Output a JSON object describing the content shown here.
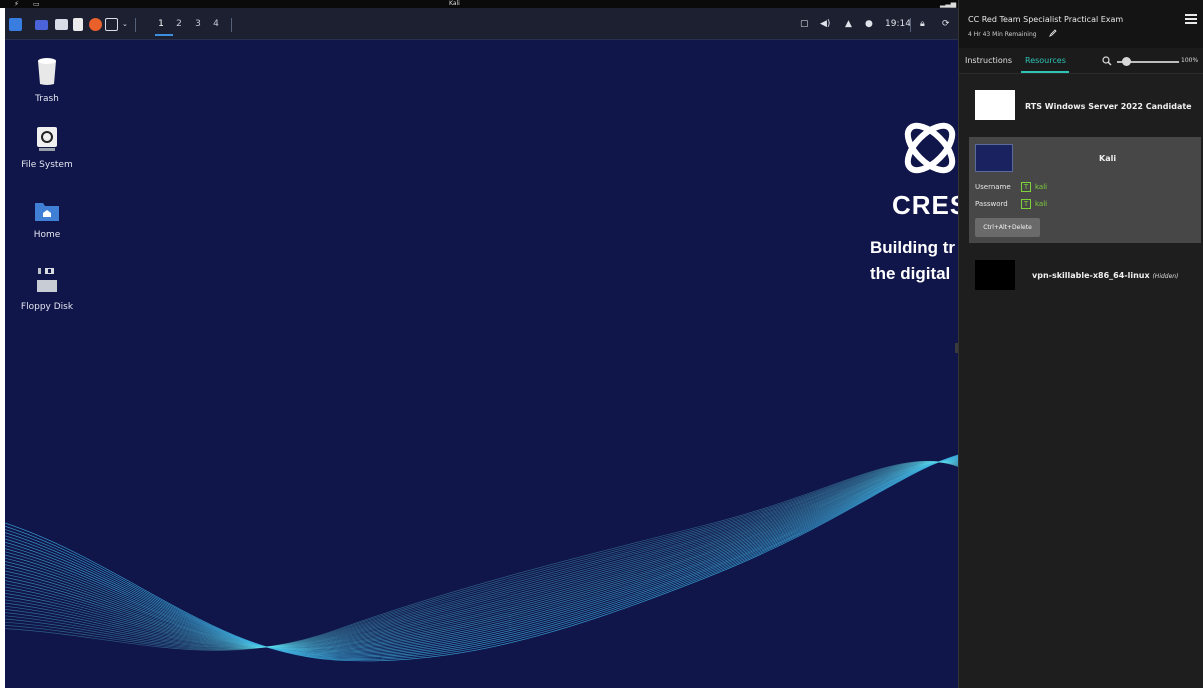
{
  "os_bar": {
    "vm_title": "Kali"
  },
  "taskbar": {
    "workspaces": [
      "1",
      "2",
      "3",
      "4"
    ],
    "clock": "19:14"
  },
  "desktop": {
    "icons": [
      {
        "label": "Trash",
        "icon": "trash-icon"
      },
      {
        "label": "File System",
        "icon": "drive-icon"
      },
      {
        "label": "Home",
        "icon": "home-folder-icon"
      },
      {
        "label": "Floppy Disk",
        "icon": "floppy-icon"
      }
    ],
    "wallpaper": {
      "logo_text": "CRES",
      "tagline_line1": "Building tr",
      "tagline_line2": "the digital"
    }
  },
  "panel": {
    "exam_title": "CC Red Team Specialist Practical Exam",
    "time_remaining": "4 Hr 43 Min Remaining",
    "tabs": [
      {
        "label": "Instructions",
        "active": false
      },
      {
        "label": "Resources",
        "active": true
      }
    ],
    "zoom": {
      "value": "100%",
      "level": 0.15
    },
    "resources": [
      {
        "name": "RTS Windows Server 2022 Candidate"
      },
      {
        "name": "Kali",
        "username_label": "Username",
        "username_value": "kali",
        "password_label": "Password",
        "password_value": "kali",
        "button": "Ctrl+Alt+Delete"
      },
      {
        "name": "vpn-skillable-x86_64-linux",
        "status": "(Hidden)"
      }
    ]
  },
  "colors": {
    "desktop_bg": "#10154a",
    "panel_bg": "#1e1e1e",
    "accent_teal": "#2ec4b6",
    "credential_green": "#7ed23a"
  }
}
